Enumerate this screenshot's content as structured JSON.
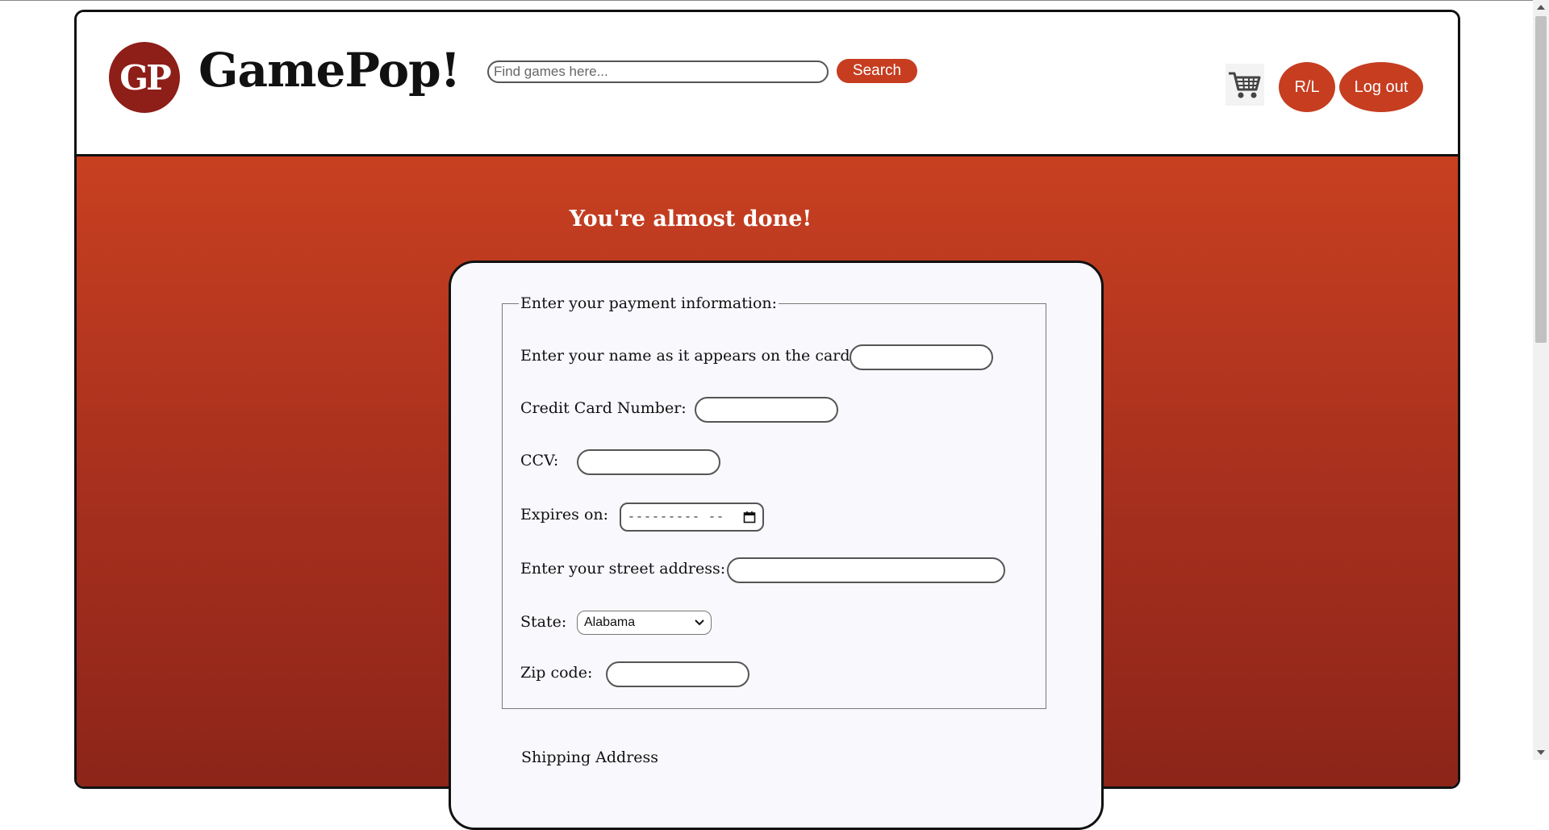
{
  "header": {
    "logo_text": "GP",
    "site_title": "GamePop!",
    "search_placeholder": "Find games here...",
    "search_label": "Search",
    "cart_icon": "shopping-cart-icon",
    "rl_label": "R/L",
    "logout_label": "Log out"
  },
  "main": {
    "heading": "You're almost done!",
    "payment_legend": "Enter your payment information:",
    "fields": {
      "name_label": "Enter your name as it appears on the card:",
      "card_label": "Credit Card Number:",
      "ccv_label": "CCV:",
      "expires_label": "Expires on:",
      "expires_value": "---------  --",
      "street_label": "Enter your street address:",
      "state_label": "State:",
      "state_value": "Alabama",
      "zip_label": "Zip code:"
    },
    "shipping_legend": "Shipping Address"
  },
  "colors": {
    "accent": "#c63d20",
    "logo": "#8e1e18",
    "gradient_top": "#c84020",
    "gradient_bottom": "#8b2419",
    "card_bg": "#f8f8fd"
  }
}
